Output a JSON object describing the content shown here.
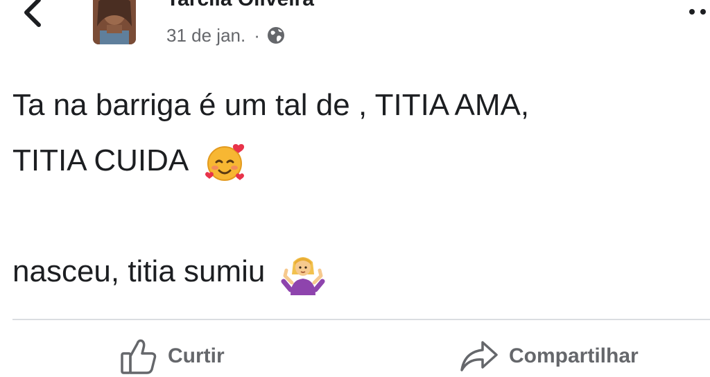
{
  "post": {
    "author_name": "Tarcila Oliveira",
    "date": "31 de jan.",
    "separator": "·",
    "audience_icon": "globe-icon",
    "text_lines": [
      "Ta na barriga é um tal de , TITIA AMA,",
      "TITIA CUIDA",
      "",
      "nasceu, titia sumiu"
    ],
    "emojis": [
      "smiling-face-with-hearts",
      "person-shrugging"
    ]
  },
  "actions": {
    "like_label": "Curtir",
    "share_label": "Compartilhar"
  },
  "colors": {
    "text": "#1c1e21",
    "secondary_text": "#65676b",
    "divider": "#dadde1",
    "background": "#ffffff"
  }
}
